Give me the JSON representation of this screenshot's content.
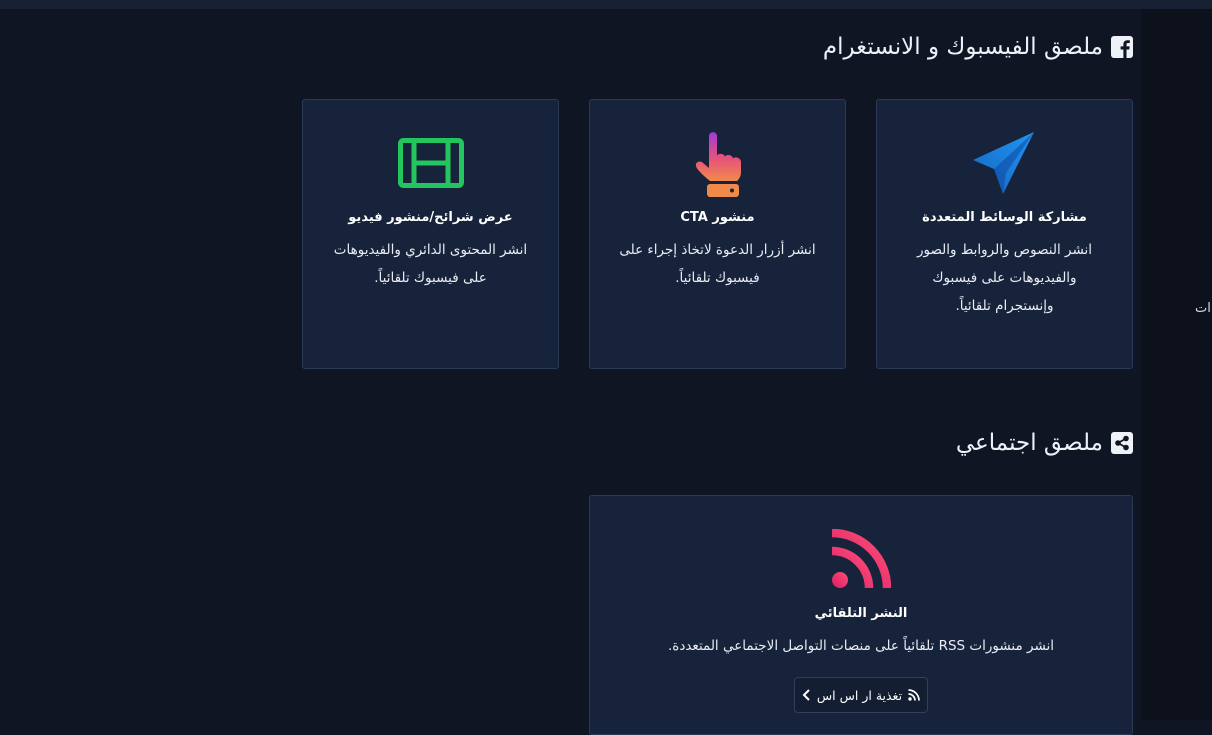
{
  "edge_text": "ات",
  "sections": {
    "facebook": {
      "title": "ملصق الفيسبوك و الانستغرام",
      "icon": "facebook-square-icon",
      "cards": [
        {
          "icon": "paper-plane-icon",
          "title": "مشاركة الوسائط المتعددة",
          "desc_lines": [
            "انشر النصوص والروابط والصور",
            "والفيديوهات على فيسبوك",
            "وإنستجرام تلقائياً."
          ]
        },
        {
          "icon": "pointing-hand-icon",
          "title": "منشور CTA",
          "desc_lines": [
            "انشر أزرار الدعوة لاتخاذ إجراء على",
            "فيسبوك تلقائياً."
          ]
        },
        {
          "icon": "film-icon",
          "title": "عرض شرائح/منشور فيديو",
          "desc_lines": [
            "انشر المحتوى الدائري والفيديوهات",
            "على فيسبوك تلقائياً."
          ]
        }
      ]
    },
    "social": {
      "title": "ملصق اجتماعي",
      "icon": "share-square-icon",
      "cards": [
        {
          "icon": "rss-icon",
          "title": "النشر التلقائي",
          "desc_lines": [
            "انشر منشورات RSS تلقائياً على منصات التواصل الاجتماعي المتعددة."
          ],
          "button_label": "تغذية ار اس اس"
        }
      ]
    }
  },
  "colors": {
    "background": "#0f1522",
    "card_bg": "#17233a",
    "card_border": "#2a3956",
    "telegram_blue": "#1976d2",
    "film_green": "#22c55e",
    "rss_pink": "#e8326a",
    "hand_gradient_start": "#a03bd6",
    "hand_gradient_end": "#f08a4b"
  }
}
